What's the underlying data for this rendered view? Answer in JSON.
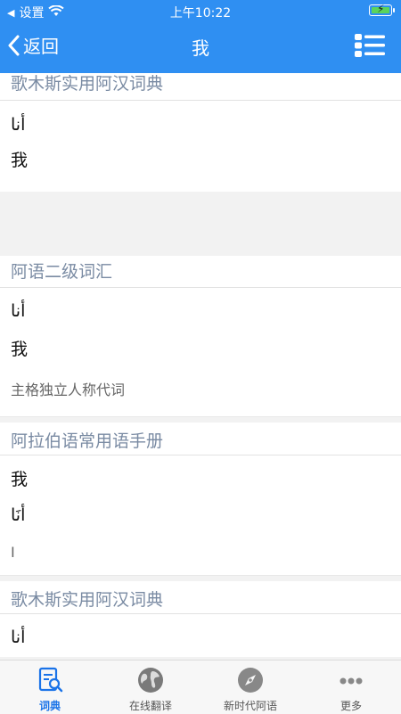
{
  "status_bar": {
    "carrier_label": "设置",
    "time": "上午10:22"
  },
  "nav": {
    "back_label": "返回",
    "title": "我"
  },
  "sections": [
    {
      "title": "歌木斯实用阿汉词典",
      "lines": [
        "أنا",
        "我"
      ]
    },
    {
      "title": "阿语二级词汇",
      "lines": [
        "أنا",
        "我",
        "主格独立人称代词"
      ]
    },
    {
      "title": "阿拉伯语常用语手册",
      "lines": [
        "我",
        "أنَا",
        "I"
      ]
    },
    {
      "title": "歌木斯实用阿汉词典",
      "lines": [
        "أنا"
      ]
    }
  ],
  "tabs": [
    {
      "label": "词典",
      "icon": "dictionary-icon",
      "active": true
    },
    {
      "label": "在线翻译",
      "icon": "globe-icon",
      "active": false
    },
    {
      "label": "新时代阿语",
      "icon": "compass-icon",
      "active": false
    },
    {
      "label": "更多",
      "icon": "more-icon",
      "active": false
    }
  ],
  "colors": {
    "header_blue": "#2f8ff2",
    "section_title": "#7a8ba3",
    "active_tab": "#1a73e8"
  }
}
